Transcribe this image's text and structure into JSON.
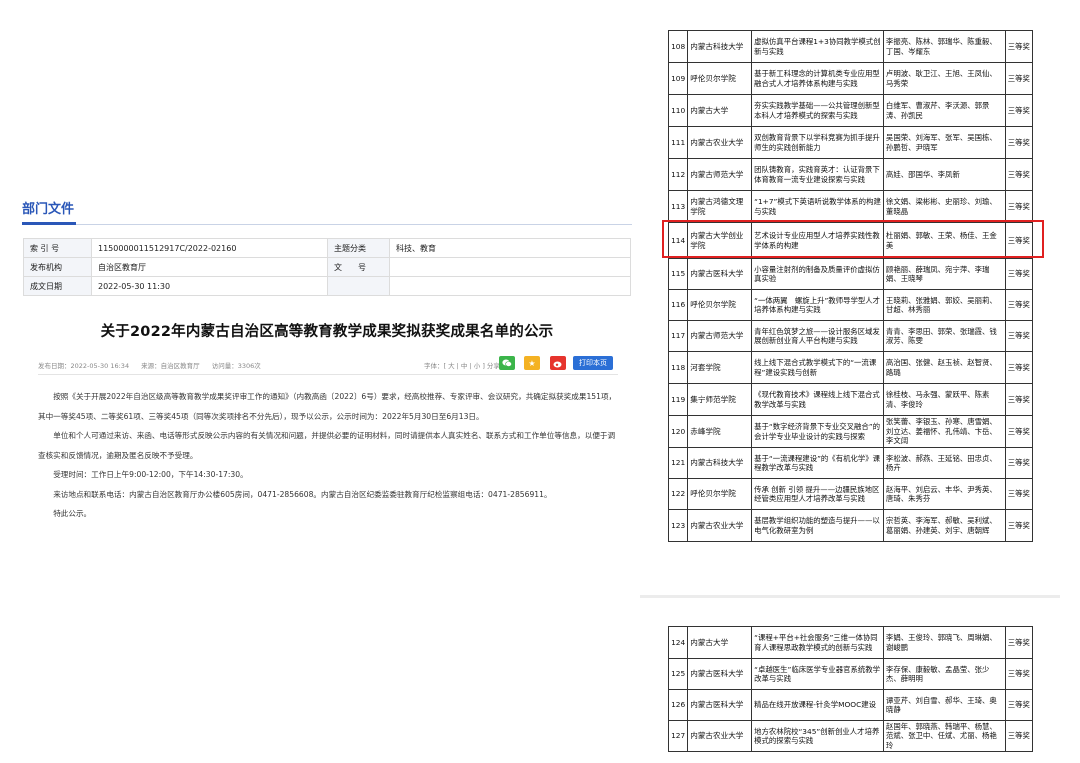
{
  "dept": {
    "section_title": "部门文件",
    "meta": {
      "index_label": "索 引 号",
      "index_value": "1150000011512917C/2022-02160",
      "topic_label": "主题分类",
      "topic_value": "科技、教育",
      "issuer_label": "发布机构",
      "issuer_value": "自治区教育厅",
      "docno_label": "文　　号",
      "docno_value": "",
      "date_label": "成文日期",
      "date_value": "2022-05-30 11:30"
    },
    "title": "关于2022年内蒙古自治区高等教育教学成果奖拟获奖成果名单的公示",
    "info": {
      "pub_date": "发布日期：2022-05-30 16:34",
      "source": "来源：自治区教育厅",
      "views": "访问量：3306次",
      "font_size": "字体：[ 大 | 中 | 小 ] 分享到",
      "print_label": "打印本页"
    },
    "body": [
      "按照《关于开展2022年自治区级高等教育教学成果奖评审工作的通知》（内教高函〔2022〕6号）要求，经高校推荐、专家评审、会议研究，共确定拟获奖成果151项，其中一等奖45项、二等奖61项、三等奖45项（同等次奖项排名不分先后），现予以公示，公示时间为：2022年5月30日至6月13日。",
      "单位和个人可通过来访、来函、电话等形式反映公示内容的有关情况和问题，并提供必要的证明材料，同时请提供本人真实姓名、联系方式和工作单位等信息，以便于调查核实和反馈情况，逾期及匿名反映不予受理。",
      "受理时间：工作日上午9:00-12:00，下午14:30-17:30。",
      "来访地点和联系电话：内蒙古自治区教育厅办公楼605房间，0471-2856608。内蒙古自治区纪委监委驻教育厅纪检监察组电话：0471-2856911。",
      "特此公示。"
    ]
  },
  "award_table_top": [
    {
      "no": "108",
      "school": "内蒙古科技大学",
      "name": "虚拟仿真平台课程1+3协同教学模式创新与实践",
      "people": "李振亮、陈林、郭瑞华、陈重毅、丁国、岑耀东",
      "award": "三等奖"
    },
    {
      "no": "109",
      "school": "呼伦贝尔学院",
      "name": "基于新工科理念的计算机类专业应用型融合式人才培养体系构建与实践",
      "people": "卢明波、耿卫江、王旭、王凤仙、马秀荣",
      "award": "三等奖"
    },
    {
      "no": "110",
      "school": "内蒙古大学",
      "name": "夯实实践教学基础——公共管理创新型本科人才培养模式的探索与实践",
      "people": "白维军、曹淑芹、李沃源、郭景涛、孙凯民",
      "award": "三等奖"
    },
    {
      "no": "111",
      "school": "内蒙古农业大学",
      "name": "双创教育背景下以学科竞赛为抓手提升师生的实践创新能力",
      "people": "吴国荣、刘海军、张军、吴国栋、孙鹏哲、尹晓军",
      "award": "三等奖"
    },
    {
      "no": "112",
      "school": "内蒙古师范大学",
      "name": "团队铸教育，实践育英才：认证背景下体育教育一流专业建设探索与实践",
      "people": "高娃、邵国华、李凤新",
      "award": "三等奖"
    },
    {
      "no": "113",
      "school": "内蒙古鸿德文理学院",
      "name": "“1+7”模式下英语听说教学体系的构建与实践",
      "people": "徐文娟、梁彬彬、史丽珍、刘瑜、董晓晶",
      "award": "三等奖"
    },
    {
      "no": "114",
      "school": "内蒙古大学创业学院",
      "name": "艺术设计专业应用型人才培养实践性教学体系的构建",
      "people": "杜丽娟、郭敏、王荣、杨佳、王金美",
      "award": "三等奖"
    },
    {
      "no": "115",
      "school": "内蒙古医科大学",
      "name": "小容量注射剂的制备及质量评价虚拟仿真实验",
      "people": "顾艳丽、薛瑞凤、宛宁萍、李瑞娟、王晓琴",
      "award": "三等奖"
    },
    {
      "no": "116",
      "school": "呼伦贝尔学院",
      "name": "“一体两翼　螺旋上升”教师导学型人才培养体系构建与实践",
      "people": "王晓莉、张雅娟、郭姣、吴丽莉、甘超、林秀丽",
      "award": "三等奖"
    },
    {
      "no": "117",
      "school": "内蒙古师范大学",
      "name": "青年红色筑梦之旅——设计服务区域发展创新创业育人平台构建与实践",
      "people": "青青、李思田、郭荣、张瑞霞、钱淑芳、陈雯",
      "award": "三等奖"
    },
    {
      "no": "118",
      "school": "河套学院",
      "name": "线上线下混合式教学模式下的“一流课程”建设实践与创新",
      "people": "高治国、张健、赵玉祯、赵智贤、路璐",
      "award": "三等奖"
    },
    {
      "no": "119",
      "school": "集宁师范学院",
      "name": "《现代教育技术》课程线上线下混合式教学改革与实践",
      "people": "徐桂枝、马永强、蒙跃平、陈素清、李俊玲",
      "award": "三等奖"
    },
    {
      "no": "120",
      "school": "赤峰学院",
      "name": "基于“数字经济背景下专业交叉融合”的会计学专业毕业设计的实践与探索",
      "people": "张笑蕾、李银玉、孙寒、唐雪娟、刘立达、姜福怀、孔伟靖、卞岳、李文阔",
      "award": "三等奖"
    },
    {
      "no": "121",
      "school": "内蒙古科技大学",
      "name": "基于“一流课程建设”的《有机化学》课程教学改革与实践",
      "people": "李松波、郝燕、王延铭、田忠贞、杨卉",
      "award": "三等奖"
    },
    {
      "no": "122",
      "school": "呼伦贝尔学院",
      "name": "传承 创新 引领 提升——边疆民族地区经管类应用型人才培养改革与实践",
      "people": "赵海平、刘启云、丰华、尹秀英、唐琦、朱秀芬",
      "award": "三等奖"
    },
    {
      "no": "123",
      "school": "内蒙古农业大学",
      "name": "基层教学组织功能的塑造与提升——以电气化教研室为例",
      "people": "宗哲英、李海军、郝敏、吴利斌、葛丽娟、孙建英、刘宇、唐朝辉",
      "award": "三等奖"
    }
  ],
  "award_table_bottom": [
    {
      "no": "124",
      "school": "内蒙古大学",
      "name": "“课程+平台+社会服务”三维一体协同育人课程思政教学模式的创新与实践",
      "people": "李娟、王俊玲、郭晓飞、周琳娟、谢峻鹏",
      "award": "三等奖"
    },
    {
      "no": "125",
      "school": "内蒙古医科大学",
      "name": "“卓越医生”临床医学专业器官系统教学改革与实践",
      "people": "李存保、康毅敏、孟晶莹、张少杰、薛明明",
      "award": "三等奖"
    },
    {
      "no": "126",
      "school": "内蒙古医科大学",
      "name": "精品在线开放课程-针灸学MOOC建设",
      "people": "谭亚芹、刘自雪、郝华、王琦、奥晓静",
      "award": "三等奖"
    },
    {
      "no": "127",
      "school": "内蒙古农业大学",
      "name": "地方农林院校“345”创新创业人才培养模式的探索与实践",
      "people": "赵国年、郭晓燕、韩瑞平、杨慧、范斌、张卫中、任斌、尤丽、杨艳玲",
      "award": "三等奖"
    }
  ],
  "colors": {
    "accent": "#2a57b8",
    "highlight": "#e02020",
    "print_button": "#2b6fd6"
  },
  "icons": [
    "wechat-icon",
    "qzone-icon",
    "weibo-icon"
  ]
}
